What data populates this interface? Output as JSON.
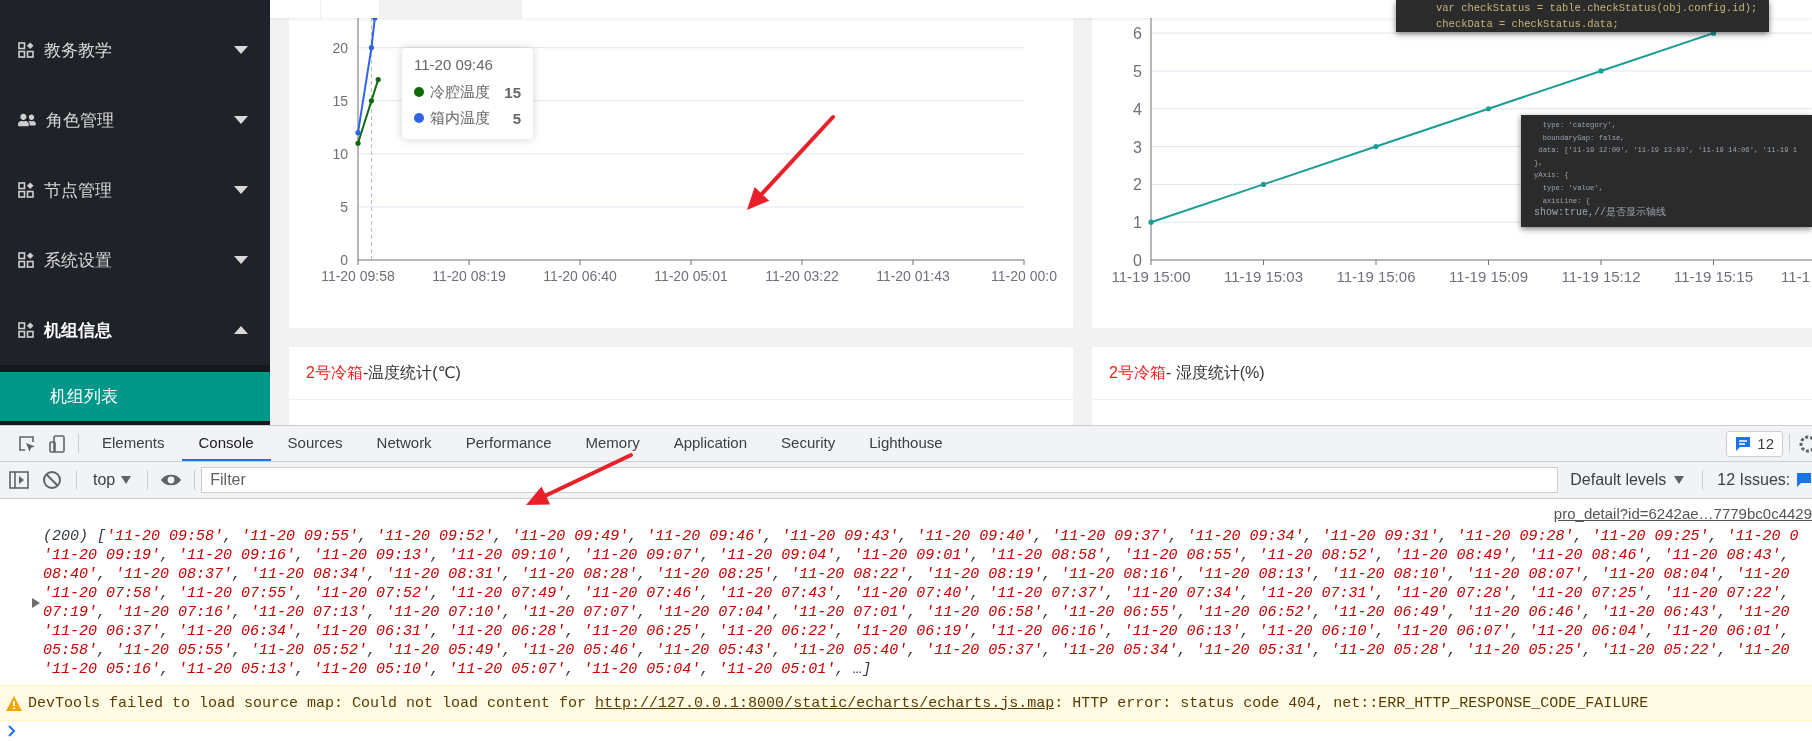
{
  "sidebar": {
    "items": [
      {
        "label": "教务教学",
        "kind": "grid",
        "expanded": false
      },
      {
        "label": "角色管理",
        "kind": "users",
        "expanded": false
      },
      {
        "label": "节点管理",
        "kind": "grid",
        "expanded": false
      },
      {
        "label": "系统设置",
        "kind": "grid",
        "expanded": false
      },
      {
        "label": "机组信息",
        "kind": "grid",
        "expanded": true,
        "children": [
          {
            "label": "机组列表",
            "selected": true
          }
        ]
      }
    ]
  },
  "page_tabs": [
    {
      "selected": false
    },
    {
      "selected": false
    },
    {
      "selected": true
    }
  ],
  "temperature_card": {
    "tooltip": {
      "title": "11-20 09:46",
      "values": [
        "15",
        "5"
      ]
    },
    "chart_data": {
      "type": "line",
      "grid": true,
      "ylim": [
        0,
        22.8
      ],
      "yticks": [
        0,
        5,
        10,
        15,
        20
      ],
      "categories": [
        "11-20 09:58",
        null,
        null,
        null,
        null,
        null,
        null,
        null,
        null,
        null,
        null,
        null,
        null,
        null,
        null,
        null,
        null,
        null,
        null,
        null,
        null,
        null,
        null,
        null,
        null,
        null,
        null,
        null,
        null,
        null,
        null,
        null,
        null,
        "11-20 08:19",
        null,
        null,
        null,
        null,
        null,
        null,
        null,
        null,
        null,
        null,
        null,
        null,
        null,
        null,
        null,
        null,
        null,
        null,
        null,
        null,
        null,
        null,
        null,
        null,
        null,
        null,
        null,
        null,
        null,
        null,
        null,
        null,
        "11-20 06:40",
        null,
        null,
        null,
        null,
        null,
        null,
        null,
        null,
        null,
        null,
        null,
        null,
        null,
        null,
        null,
        null,
        null,
        null,
        null,
        null,
        null,
        null,
        null,
        null,
        null,
        null,
        null,
        null,
        null,
        null,
        null,
        null,
        "11-20 05:01",
        null,
        null,
        null,
        null,
        null,
        null,
        null,
        null,
        null,
        null,
        null,
        null,
        null,
        null,
        null,
        null,
        null,
        null,
        null,
        null,
        null,
        null,
        null,
        null,
        null,
        null,
        null,
        null,
        null,
        null,
        null,
        null,
        "11-20 03:22",
        null,
        null,
        null,
        null,
        null,
        null,
        null,
        null,
        null,
        null,
        null,
        null,
        null,
        null,
        null,
        null,
        null,
        null,
        null,
        null,
        null,
        null,
        null,
        null,
        null,
        null,
        null,
        null,
        null,
        null,
        null,
        null,
        "11-20 01:43",
        null,
        null,
        null,
        null,
        null,
        null,
        null,
        null,
        null,
        null,
        null,
        null,
        null,
        null,
        null,
        null,
        null,
        null,
        null,
        null,
        null,
        null,
        null,
        null,
        null,
        null,
        null,
        null,
        null,
        null,
        null,
        null,
        "11-20 00:0"
      ],
      "series": [
        {
          "name": "冷腔温度",
          "color": "#0b6b0b",
          "values": [
            11,
            null,
            null,
            null,
            15,
            null,
            17,
            null,
            null,
            null,
            null,
            null,
            null,
            null,
            null,
            null,
            null,
            null,
            null,
            null,
            null,
            null,
            null,
            null,
            null,
            null,
            null,
            null,
            null,
            null,
            null,
            null,
            null,
            null,
            null,
            null,
            null,
            null,
            null,
            null,
            null,
            null,
            null,
            null,
            null,
            null,
            null,
            null,
            null,
            null,
            null,
            null,
            null,
            null,
            null,
            null,
            null,
            null,
            null,
            null,
            null,
            null,
            null,
            null,
            null,
            null,
            null,
            null,
            null,
            null,
            null,
            null,
            null,
            null,
            null,
            null,
            null,
            null,
            null,
            null,
            null,
            null,
            null,
            null,
            null,
            null,
            null,
            null,
            null,
            null,
            null,
            null,
            null,
            null,
            null,
            null,
            null,
            null,
            null,
            null,
            null,
            null,
            null,
            null,
            null,
            null,
            null,
            null,
            null,
            null,
            null,
            null,
            null,
            null,
            null,
            null,
            null,
            null,
            null,
            null,
            null,
            null,
            null,
            null,
            null,
            null,
            null,
            null,
            null,
            null,
            null,
            null,
            null,
            null,
            null,
            null,
            null,
            null,
            null,
            null,
            null,
            null,
            null,
            null,
            null,
            null,
            null,
            null,
            null,
            null,
            null,
            null,
            null,
            null,
            null,
            null,
            null,
            null,
            null,
            null,
            null,
            null,
            null,
            null,
            null,
            null,
            null,
            null,
            null,
            null,
            null,
            null,
            null,
            null,
            null,
            null,
            null,
            null,
            null,
            null,
            null,
            null,
            null,
            null,
            null,
            null,
            null,
            null,
            null,
            null,
            null,
            null,
            null,
            null,
            null,
            null,
            null,
            null,
            null
          ]
        },
        {
          "name": "箱内温度",
          "color": "#2f63e8",
          "values": [
            12,
            null,
            null,
            null,
            20,
            22.8,
            null,
            null,
            null,
            null,
            null,
            null,
            null,
            null,
            null,
            null,
            null,
            null,
            null,
            null,
            null,
            null,
            null,
            null,
            null,
            null,
            null,
            null,
            null,
            null,
            null,
            null,
            null,
            null,
            null,
            null,
            null,
            null,
            null,
            null,
            null,
            null,
            null,
            null,
            null,
            null,
            null,
            null,
            null,
            null,
            null,
            null,
            null,
            null,
            null,
            null,
            null,
            null,
            null,
            null,
            null,
            null,
            null,
            null,
            null,
            null,
            null,
            null,
            null,
            null,
            null,
            null,
            null,
            null,
            null,
            null,
            null,
            null,
            null,
            null,
            null,
            null,
            null,
            null,
            null,
            null,
            null,
            null,
            null,
            null,
            null,
            null,
            null,
            null,
            null,
            null,
            null,
            null,
            null,
            null,
            null,
            null,
            null,
            null,
            null,
            null,
            null,
            null,
            null,
            null,
            null,
            null,
            null,
            null,
            null,
            null,
            null,
            null,
            null,
            null,
            null,
            null,
            null,
            null,
            null,
            null,
            null,
            null,
            null,
            null,
            null,
            null,
            null,
            null,
            null,
            null,
            null,
            null,
            null,
            null,
            null,
            null,
            null,
            null,
            null,
            null,
            null,
            null,
            null,
            null,
            null,
            null,
            null,
            null,
            null,
            null,
            null,
            null,
            null,
            null,
            null,
            null,
            null,
            null,
            null,
            null,
            null,
            null,
            null,
            null,
            null,
            null,
            null,
            null,
            null,
            null,
            null,
            null,
            null,
            null,
            null,
            null,
            null,
            null,
            null,
            null,
            null,
            null,
            null,
            null,
            null,
            null,
            null,
            null,
            null,
            null,
            null,
            null,
            null
          ]
        }
      ]
    }
  },
  "humidity_card": {
    "chart_data": {
      "type": "line",
      "grid": true,
      "categories": [
        "11-19 15:00",
        "11-19 15:03",
        "11-19 15:06",
        "11-19 15:09",
        "11-19 15:12",
        "11-19 15:15",
        "11-1"
      ],
      "values": [
        1,
        2,
        3,
        4,
        5,
        6,
        null
      ],
      "color": "#1a9e93",
      "ylim": [
        0,
        6.4
      ],
      "yticks": [
        0,
        1,
        2,
        3,
        4,
        5,
        6
      ]
    }
  },
  "code_snippets": [
    {
      "lines": [
        "var checkStatus = table.checkStatus(obj.config.id);",
        "checkData = checkStatus.data;"
      ]
    },
    {
      "lines": [
        "  type: 'category',",
        "  boundaryGap: false,",
        " data: ['11-19 12:00', '11-19 13:03', '11-19 14:06', '11-19 1",
        "},",
        "yAxis: {",
        "  type: 'value',",
        "  axisLine: {",
        "show:true,//是否显示轴线"
      ]
    }
  ],
  "lower_cards": [
    {
      "highlight": "2号冷箱",
      "title": "-温度统计(℃)"
    },
    {
      "highlight": "2号冷箱",
      "title": "- 湿度统计(%)"
    }
  ],
  "devtools": {
    "tabs": [
      {
        "label": "Elements",
        "selected": false
      },
      {
        "label": "Console",
        "selected": true
      },
      {
        "label": "Sources",
        "selected": false
      },
      {
        "label": "Network",
        "selected": false
      },
      {
        "label": "Performance",
        "selected": false
      },
      {
        "label": "Memory",
        "selected": false
      },
      {
        "label": "Application",
        "selected": false
      },
      {
        "label": "Security",
        "selected": false
      },
      {
        "label": "Lighthouse",
        "selected": false
      }
    ],
    "issues_badge": "12",
    "context": "top",
    "filter_placeholder": "Filter",
    "levels": "Default levels",
    "issues": "12 Issues:",
    "source_link": "pro_detail?id=6242ae…7779bc0c4429",
    "log_lines": [
      {
        "text": "(200) ['11-20 09:58', '11-20 09:55', '11-20 09:52', '11-20 09:49', '11-20 09:46', '11-20 09:43', '11-20 09:40', '11-20 09:37', '11-20 09:34', '11-20 09:31', '11-20 09:28', '11-20 09:25', '11-20 0",
        "continued": false
      },
      {
        "text": "'11-20 09:19', '11-20 09:16', '11-20 09:13', '11-20 09:10', '11-20 09:07', '11-20 09:04', '11-20 09:01', '11-20 08:58', '11-20 08:55', '11-20 08:52', '11-20 08:49', '11-20 08:46', '11-20 08:43',",
        "continued": false
      },
      {
        "text": "08:40', '11-20 08:37', '11-20 08:34', '11-20 08:31', '11-20 08:28', '11-20 08:25', '11-20 08:22', '11-20 08:19', '11-20 08:16', '11-20 08:13', '11-20 08:10', '11-20 08:07', '11-20 08:04', '11-20",
        "continued": true
      },
      {
        "text": "'11-20 07:58', '11-20 07:55', '11-20 07:52', '11-20 07:49', '11-20 07:46', '11-20 07:43', '11-20 07:40', '11-20 07:37', '11-20 07:34', '11-20 07:31', '11-20 07:28', '11-20 07:25', '11-20 07:22',",
        "continued": false
      },
      {
        "text": "07:19', '11-20 07:16', '11-20 07:13', '11-20 07:10', '11-20 07:07', '11-20 07:04', '11-20 07:01', '11-20 06:58', '11-20 06:55', '11-20 06:52', '11-20 06:49', '11-20 06:46', '11-20 06:43', '11-20",
        "continued": true
      },
      {
        "text": "'11-20 06:37', '11-20 06:34', '11-20 06:31', '11-20 06:28', '11-20 06:25', '11-20 06:22', '11-20 06:19', '11-20 06:16', '11-20 06:13', '11-20 06:10', '11-20 06:07', '11-20 06:04', '11-20 06:01',",
        "continued": false
      },
      {
        "text": "05:58', '11-20 05:55', '11-20 05:52', '11-20 05:49', '11-20 05:46', '11-20 05:43', '11-20 05:40', '11-20 05:37', '11-20 05:34', '11-20 05:31', '11-20 05:28', '11-20 05:25', '11-20 05:22', '11-20",
        "continued": true
      },
      {
        "text": "'11-20 05:16', '11-20 05:13', '11-20 05:10', '11-20 05:07', '11-20 05:04', '11-20 05:01', …]",
        "continued": false
      }
    ],
    "warning": {
      "text": "DevTools failed to load source map: Could not load content for ",
      "link": "http://127.0.0.1:8000/static/echarts/echarts.js.map",
      "after": ": HTTP error: status code 404, net::ERR_HTTP_RESPONSE_CODE_FAILURE"
    }
  }
}
